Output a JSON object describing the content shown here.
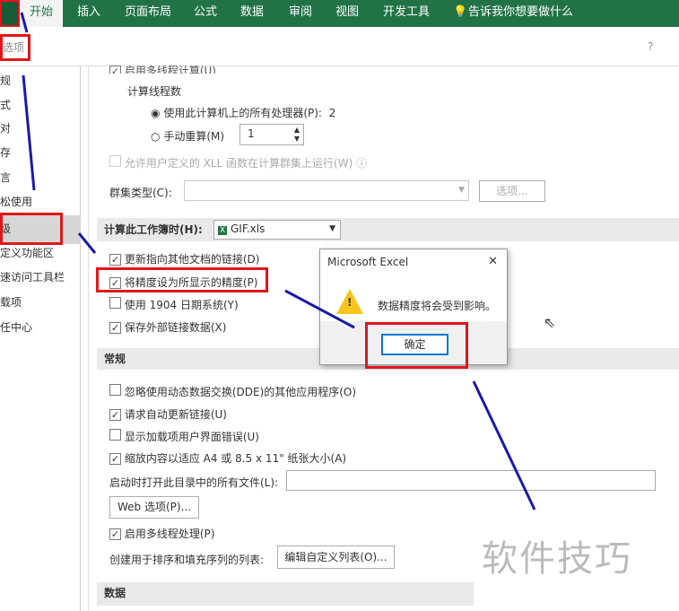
{
  "ribbon": {
    "tabs": [
      "开始",
      "插入",
      "页面布局",
      "公式",
      "数据",
      "审阅",
      "视图",
      "开发工具"
    ],
    "tell_me": "告诉我你想要做什么"
  },
  "dialog_title": "选项",
  "help": "?",
  "sidebar": {
    "items": [
      "规",
      "式",
      "对",
      "存",
      "言",
      "松使用",
      "级",
      "定义功能区",
      "速访问工具栏",
      "载项",
      "任中心"
    ]
  },
  "main": {
    "top_cut": "启用多线程计算(U)",
    "threads_label": "计算线程数",
    "use_all": "使用此计算机上的所有处理器(P):",
    "use_all_value": "2",
    "manual": "手动重算(M)",
    "manual_value": "1",
    "xll": "允许用户定义的 XLL 函数在计算群集上运行(W)",
    "cluster_label": "群集类型(C):",
    "cluster_btn": "选项...",
    "workbook_section": "计算此工作簿时(H):",
    "workbook_value": "GIF.xls",
    "opts": [
      {
        "label": "更新指向其他文档的链接(D)",
        "checked": true
      },
      {
        "label": "将精度设为所显示的精度(P)",
        "checked": true
      },
      {
        "label": "使用 1904 日期系统(Y)",
        "checked": false
      },
      {
        "label": "保存外部链接数据(X)",
        "checked": true
      }
    ],
    "general_section": "常规",
    "general": [
      {
        "label": "忽略使用动态数据交换(DDE)的其他应用程序(O)",
        "checked": false
      },
      {
        "label": "请求自动更新链接(U)",
        "checked": true
      },
      {
        "label": "显示加载项用户界面错误(U)",
        "checked": false
      },
      {
        "label": "缩放内容以适应 A4 或 8.5 x 11\" 纸张大小(A)",
        "checked": true
      }
    ],
    "startup_label": "启动时打开此目录中的所有文件(L):",
    "web_btn": "Web 选项(P)...",
    "multithread": "启用多线程处理(P)",
    "custom_list_label": "创建用于排序和填充序列的列表:",
    "custom_list_btn": "编辑自定义列表(O)...",
    "data_section": "数据"
  },
  "msgbox": {
    "title": "Microsoft Excel",
    "message": "数据精度将会受到影响。",
    "ok": "确定",
    "close": "✕",
    "warning": "!"
  },
  "watermark": "软件技巧",
  "colors": {
    "ribbon": "#217346",
    "highlight": "#e0161b",
    "arrow": "#1a1aa8"
  }
}
